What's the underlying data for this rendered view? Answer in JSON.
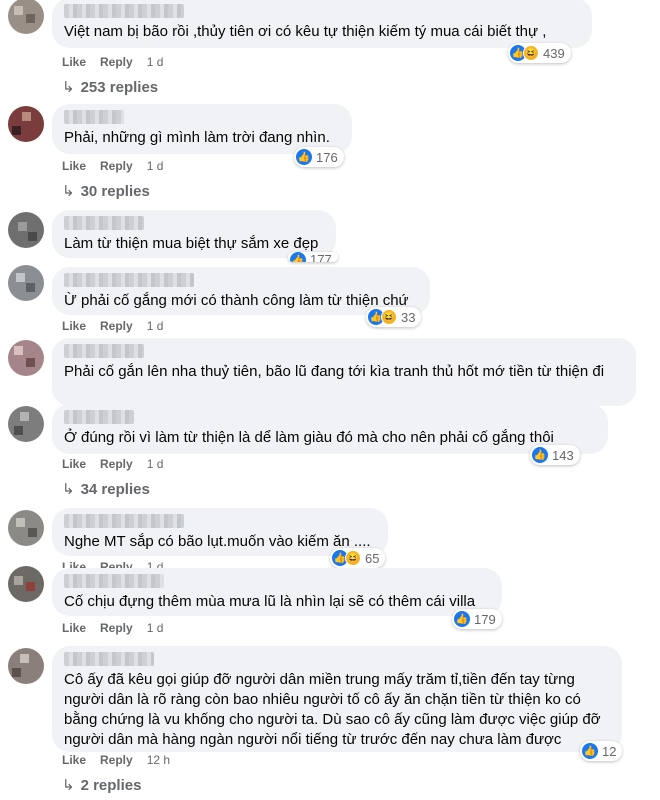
{
  "labels": {
    "like": "Like",
    "reply": "Reply"
  },
  "comments": [
    {
      "text": "Việt nam bị bão rồi ,thủy tiên ơi có kêu tự thiện kiếm tý mua cái biết thự ,",
      "time": "1 d",
      "reactions": "439",
      "replies": "253 replies"
    },
    {
      "text": "Phải, những gì mình làm trời đang nhìn.",
      "time": "1 d",
      "reactions": "176",
      "replies": "30 replies"
    },
    {
      "text": "Làm từ thiện mua biệt thự sắm xe đẹp",
      "reactions": "177"
    },
    {
      "text": "Ừ phải cố gắng mới có thành công làm từ thiện chứ",
      "time": "1 d",
      "reactions": "33"
    },
    {
      "text": "Phải cố gắn lên nha thuỷ tiên, bão lũ đang tới kìa tranh thủ hốt mớ tiền từ thiện đi"
    },
    {
      "text": "Ở đúng rồi vì làm từ thiện là dể làm giàu đó mà cho nên phải cố gắng thôi",
      "time": "1 d",
      "reactions": "143",
      "replies": "34 replies"
    },
    {
      "text": "Nghe MT sắp có bão lụt.muốn vào kiếm ăn ....",
      "time": "1 d",
      "reactions": "65"
    },
    {
      "text": "Cố chịu đựng thêm mùa mưa lũ là nhìn lại sẽ có thêm cái villa",
      "time": "1 d",
      "reactions": "179"
    },
    {
      "text": "Cô ấy đã kêu gọi giúp đỡ người dân miền trung mấy trăm tỉ,tiền đến tay từng người dân là rõ ràng còn bao nhiêu người tố cô ấy ăn chặn tiền từ thiện ko có bằng chứng là vu khống cho người ta. Dù sao cô ấy cũng làm được việc giúp đỡ người dân mà hàng ngàn người nổi tiếng từ trước đến nay chưa làm được",
      "time": "12 h",
      "reactions": "12",
      "replies": "2 replies"
    }
  ],
  "colors": {
    "bubble": "#f0f2f5",
    "like": "#1877f2",
    "haha": "#f7b125",
    "meta": "#65676b"
  },
  "icons": {
    "like": "like-reaction-icon",
    "haha": "haha-reaction-icon",
    "reply_arrow": "reply-arrow-icon"
  }
}
